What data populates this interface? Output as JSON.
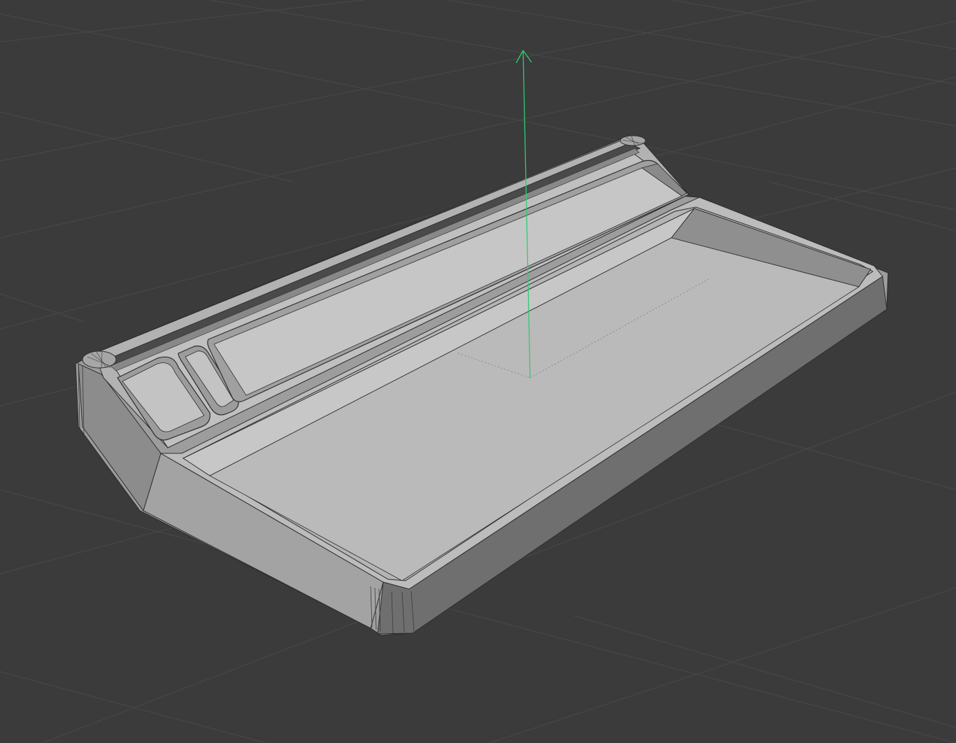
{
  "viewport": {
    "background": "#3b3b3b",
    "grid_color": "#444444",
    "grid_visible": true,
    "axis_color": "#2ecc71"
  },
  "model": {
    "body_light": "#c2c2c2",
    "body_mid": "#a9a9a9",
    "body_dark": "#8a8a8a",
    "edge_line": "#2e2e2e",
    "icon": "3d-model-tray"
  },
  "gizmo": {
    "axis": "up",
    "icon": "arrow-up-icon"
  }
}
